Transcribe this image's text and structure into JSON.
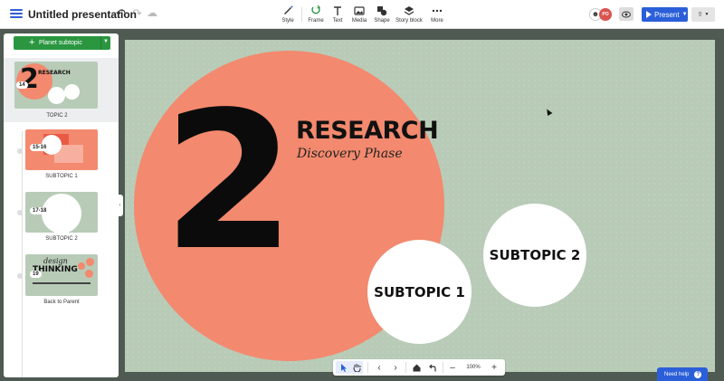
{
  "app": {
    "doc_title": "Untitled presentation"
  },
  "toolbar": {
    "tools": [
      {
        "label": "Style",
        "icon": "style-icon"
      },
      {
        "label": "Frame",
        "icon": "frame-icon"
      },
      {
        "label": "Text",
        "icon": "text-icon"
      },
      {
        "label": "Media",
        "icon": "media-icon"
      },
      {
        "label": "Shape",
        "icon": "shape-icon"
      },
      {
        "label": "Story block",
        "icon": "story-block-icon"
      },
      {
        "label": "More",
        "icon": "more-icon"
      }
    ],
    "present_label": "Present",
    "avatar_badge": "PO"
  },
  "sidebar": {
    "add_button_label": "Planet subtopic",
    "items": [
      {
        "label": "TOPIC 2",
        "badge": "14"
      },
      {
        "label": "SUBTOPIC 1",
        "badge": "15-16"
      },
      {
        "label": "SUBTOPIC 2",
        "badge": "17-18"
      },
      {
        "label": "Back to Parent",
        "badge": "19"
      }
    ],
    "thumb_topic": {
      "title": "RESEARCH",
      "digit": "2"
    },
    "thumb_back": {
      "word1": "design",
      "word2": "THINKING"
    }
  },
  "canvas": {
    "big_number": "2",
    "title": "RESEARCH",
    "subtitle": "Discovery Phase",
    "subtopic1": "SUBTOPIC 1",
    "subtopic2": "SUBTOPIC 2",
    "colors": {
      "background": "#b8cbb7",
      "main_circle": "#f3896e",
      "subtopic_circle": "#ffffff"
    }
  },
  "bottom_toolbar": {
    "zoom": "100%"
  },
  "help": {
    "label": "Need help"
  },
  "colors": {
    "accent_blue": "#2b5fd9",
    "green_button": "#2a9740"
  }
}
